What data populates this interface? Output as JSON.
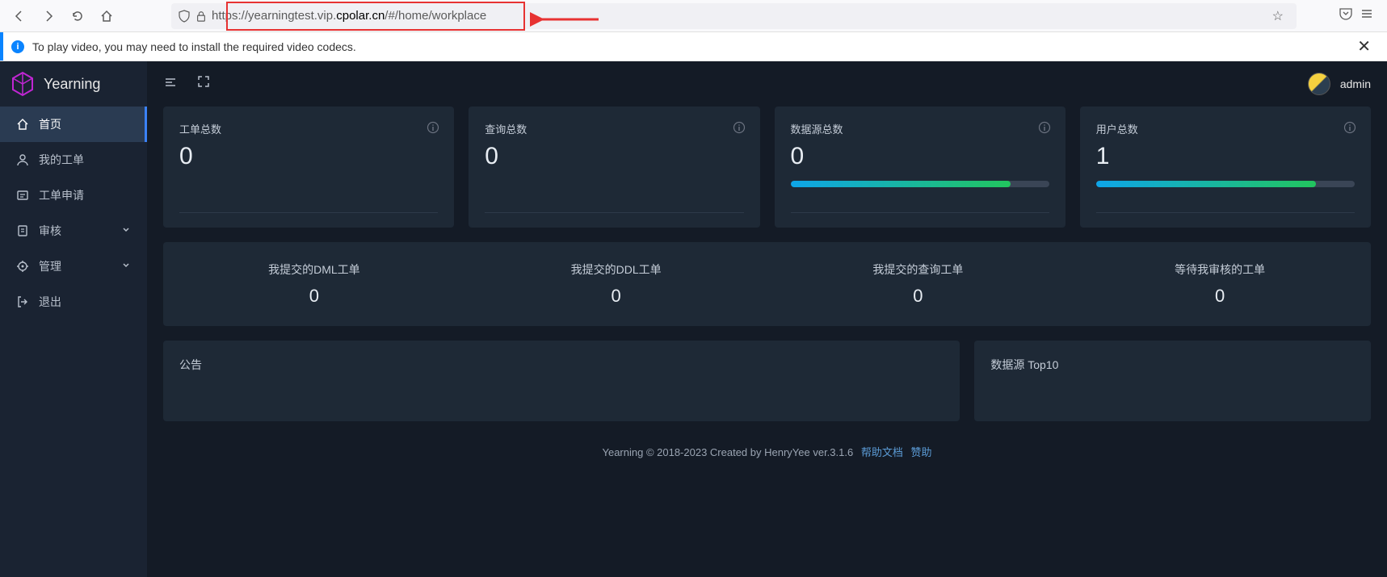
{
  "browser": {
    "url_prefix": "https://yearningtest.vip.",
    "url_domain": "cpolar.cn",
    "url_suffix": "/#/home/workplace"
  },
  "infobar": {
    "message": "To play video, you may need to install the required video codecs."
  },
  "brand": "Yearning",
  "sidebar": {
    "items": [
      {
        "label": "首页",
        "icon": "home-icon"
      },
      {
        "label": "我的工单",
        "icon": "user-icon"
      },
      {
        "label": "工单申请",
        "icon": "ticket-icon"
      },
      {
        "label": "审核",
        "icon": "audit-icon",
        "has_children": true
      },
      {
        "label": "管理",
        "icon": "manage-icon",
        "has_children": true
      },
      {
        "label": "退出",
        "icon": "logout-icon"
      }
    ]
  },
  "user": {
    "name": "admin"
  },
  "stats": [
    {
      "title": "工单总数",
      "value": "0",
      "progress": null
    },
    {
      "title": "查询总数",
      "value": "0",
      "progress": null
    },
    {
      "title": "数据源总数",
      "value": "0",
      "progress": 85
    },
    {
      "title": "用户总数",
      "value": "1",
      "progress": 85
    }
  ],
  "mini_stats": [
    {
      "label": "我提交的DML工单",
      "value": "0"
    },
    {
      "label": "我提交的DDL工单",
      "value": "0"
    },
    {
      "label": "我提交的查询工单",
      "value": "0"
    },
    {
      "label": "等待我审核的工单",
      "value": "0"
    }
  ],
  "panels": {
    "announce": "公告",
    "datasource_top": "数据源 Top10"
  },
  "footer": {
    "text": "Yearning © 2018-2023 Created by HenryYee ver.3.1.6",
    "link1": "帮助文档",
    "link2": "赞助"
  }
}
